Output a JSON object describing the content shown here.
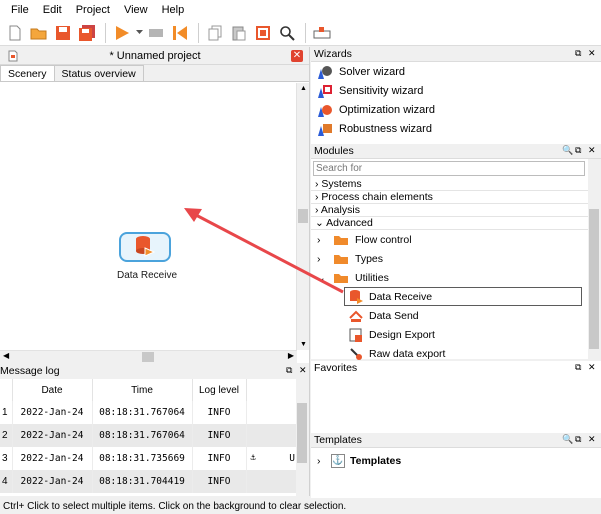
{
  "menu": [
    "File",
    "Edit",
    "Project",
    "View",
    "Help"
  ],
  "editor": {
    "title": "* Unnamed project",
    "tabs": [
      "Scenery",
      "Status overview"
    ],
    "node_label": "Data Receive"
  },
  "log": {
    "title": "Message log",
    "columns": [
      "Date",
      "Time",
      "Log level"
    ],
    "rows": [
      {
        "n": "1",
        "date": "2022-Jan-24",
        "time": "08:18:31.767064",
        "level": "INFO",
        "extra": ""
      },
      {
        "n": "2",
        "date": "2022-Jan-24",
        "time": "08:18:31.767064",
        "level": "INFO",
        "extra": ""
      },
      {
        "n": "3",
        "date": "2022-Jan-24",
        "time": "08:18:31.735669",
        "level": "INFO",
        "extra": "U"
      },
      {
        "n": "4",
        "date": "2022-Jan-24",
        "time": "08:18:31.704419",
        "level": "INFO",
        "extra": ""
      }
    ]
  },
  "wizards": {
    "title": "Wizards",
    "items": [
      "Solver wizard",
      "Sensitivity wizard",
      "Optimization wizard",
      "Robustness wizard"
    ]
  },
  "modules": {
    "title": "Modules",
    "search_placeholder": "Search for",
    "categories": [
      "Systems",
      "Process chain elements",
      "Analysis",
      "Advanced"
    ],
    "folders": [
      "Flow control",
      "Types",
      "Utilities"
    ],
    "utilities": [
      "Data Receive",
      "Data Send",
      "Design Export",
      "Raw data export"
    ]
  },
  "favorites": {
    "title": "Favorites"
  },
  "templates": {
    "title": "Templates",
    "items": [
      "Templates"
    ]
  },
  "status": "Ctrl+ Click to select multiple items. Click on the background to clear selection.",
  "colors": {
    "accent": "#4ba3dc",
    "arrow": "#e8474a",
    "folder": "#f08a2b"
  }
}
